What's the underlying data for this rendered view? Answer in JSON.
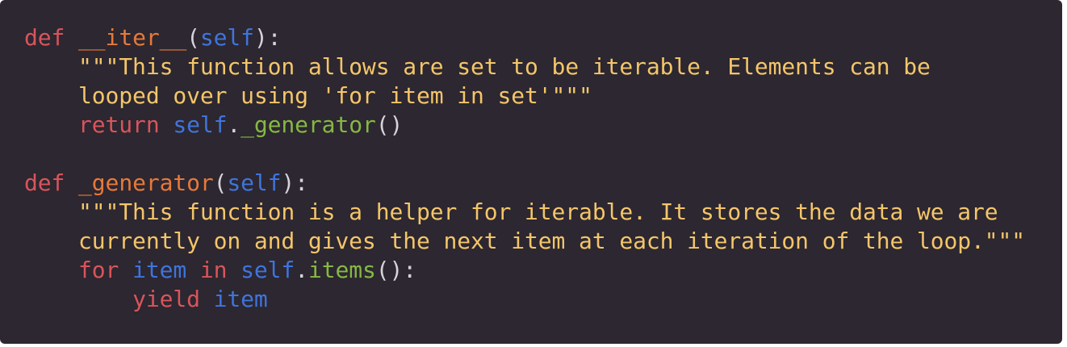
{
  "editor": {
    "language": "python",
    "theme": {
      "background": "#2c2730",
      "keyword": "#d9545c",
      "function_name": "#e7793a",
      "self_variable": "#3f74dc",
      "string": "#f4c56a",
      "method_call": "#86b843",
      "punctuation": "#d6d3da"
    },
    "lines": [
      [
        {
          "t": "def",
          "c": "kw"
        },
        {
          "t": " ",
          "c": "punc"
        },
        {
          "t": "__iter__",
          "c": "fn"
        },
        {
          "t": "(",
          "c": "punc"
        },
        {
          "t": "self",
          "c": "self"
        },
        {
          "t": "):",
          "c": "punc"
        }
      ],
      [
        {
          "t": "    ",
          "c": "punc"
        },
        {
          "t": "\"\"\"This function allows are set to be iterable. Elements can be",
          "c": "str"
        }
      ],
      [
        {
          "t": "    ",
          "c": "punc"
        },
        {
          "t": "looped over using 'for item in set'\"\"\"",
          "c": "str"
        }
      ],
      [
        {
          "t": "    ",
          "c": "punc"
        },
        {
          "t": "return",
          "c": "kw"
        },
        {
          "t": " ",
          "c": "punc"
        },
        {
          "t": "self",
          "c": "self"
        },
        {
          "t": ".",
          "c": "punc"
        },
        {
          "t": "_generator",
          "c": "call"
        },
        {
          "t": "()",
          "c": "punc"
        }
      ],
      [],
      [
        {
          "t": "def",
          "c": "kw"
        },
        {
          "t": " ",
          "c": "punc"
        },
        {
          "t": "_generator",
          "c": "fn"
        },
        {
          "t": "(",
          "c": "punc"
        },
        {
          "t": "self",
          "c": "self"
        },
        {
          "t": "):",
          "c": "punc"
        }
      ],
      [
        {
          "t": "    ",
          "c": "punc"
        },
        {
          "t": "\"\"\"This function is a helper for iterable. It stores the data we are",
          "c": "str"
        }
      ],
      [
        {
          "t": "    ",
          "c": "punc"
        },
        {
          "t": "currently on and gives the next item at each iteration of the loop.\"\"\"",
          "c": "str"
        }
      ],
      [
        {
          "t": "    ",
          "c": "punc"
        },
        {
          "t": "for",
          "c": "kw"
        },
        {
          "t": " ",
          "c": "punc"
        },
        {
          "t": "item",
          "c": "var"
        },
        {
          "t": " ",
          "c": "punc"
        },
        {
          "t": "in",
          "c": "kw"
        },
        {
          "t": " ",
          "c": "punc"
        },
        {
          "t": "self",
          "c": "self"
        },
        {
          "t": ".",
          "c": "punc"
        },
        {
          "t": "items",
          "c": "call"
        },
        {
          "t": "():",
          "c": "punc"
        }
      ],
      [
        {
          "t": "        ",
          "c": "punc"
        },
        {
          "t": "yield",
          "c": "kw"
        },
        {
          "t": " ",
          "c": "punc"
        },
        {
          "t": "item",
          "c": "var"
        }
      ]
    ]
  }
}
